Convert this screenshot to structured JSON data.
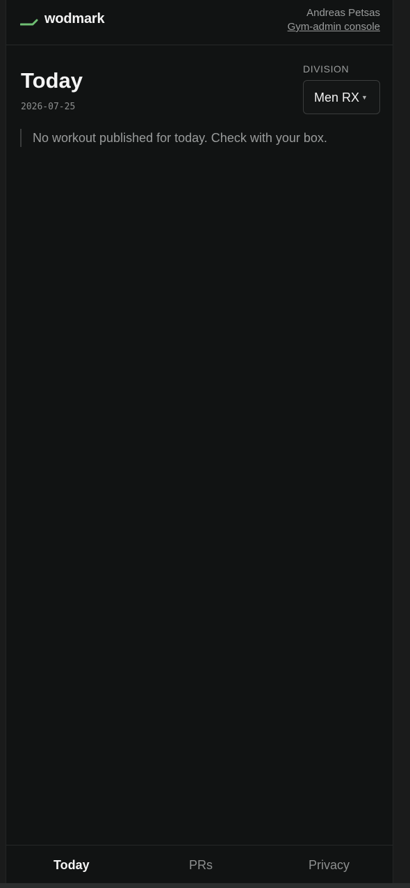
{
  "header": {
    "brand": "wodmark",
    "user_name": "Andreas Petsas",
    "console_link": "Gym-admin console",
    "accent_color": "#6fbf73"
  },
  "main": {
    "title": "Today",
    "date": "2026-07-25",
    "division": {
      "label": "DIVISION",
      "selected": "Men RX"
    },
    "empty_message": "No workout published for today. Check with your box."
  },
  "tabs": [
    {
      "label": "Today",
      "active": true
    },
    {
      "label": "PRs",
      "active": false
    },
    {
      "label": "Privacy",
      "active": false
    }
  ]
}
